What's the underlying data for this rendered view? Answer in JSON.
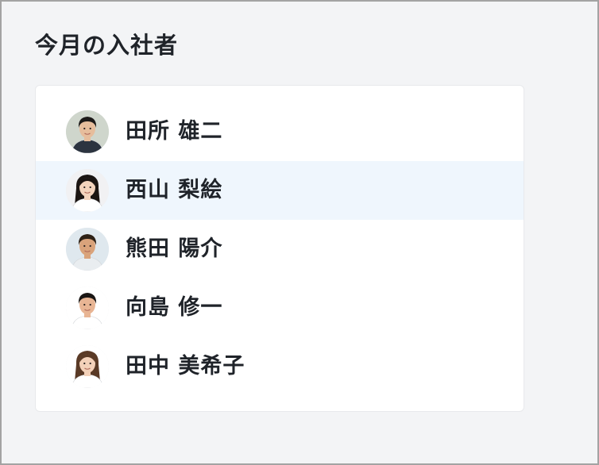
{
  "panel": {
    "title": "今月の入社者"
  },
  "new_hires": [
    {
      "name": "田所 雄二",
      "avatar": "man-suit-photo-icon",
      "selected": false,
      "bg": "#cfd6cc",
      "hair": "#1c1a19",
      "skin": "#e6bd9c",
      "shirt": "#2c3440",
      "hair_style": "short"
    },
    {
      "name": "西山 梨絵",
      "avatar": "woman-long-hair-photo-icon",
      "selected": true,
      "bg": "#f1f1f3",
      "hair": "#1b1512",
      "skin": "#f3d4bd",
      "shirt": "#ffffff",
      "hair_style": "long"
    },
    {
      "name": "熊田 陽介",
      "avatar": "man-smiling-photo-icon",
      "selected": false,
      "bg": "#dfe8ee",
      "hair": "#2d2116",
      "skin": "#d9a37b",
      "shirt": "#e9edf0",
      "hair_style": "short"
    },
    {
      "name": "向島 修一",
      "avatar": "man-casual-photo-icon",
      "selected": false,
      "bg": "#ffffff",
      "hair": "#1a1614",
      "skin": "#e8b594",
      "shirt": "#ffffff",
      "hair_style": "short"
    },
    {
      "name": "田中 美希子",
      "avatar": "woman-ponytail-photo-icon",
      "selected": false,
      "bg": "#ffffff",
      "hair": "#5a3a26",
      "skin": "#f3d1b9",
      "shirt": "#ffffff",
      "hair_style": "long"
    }
  ]
}
